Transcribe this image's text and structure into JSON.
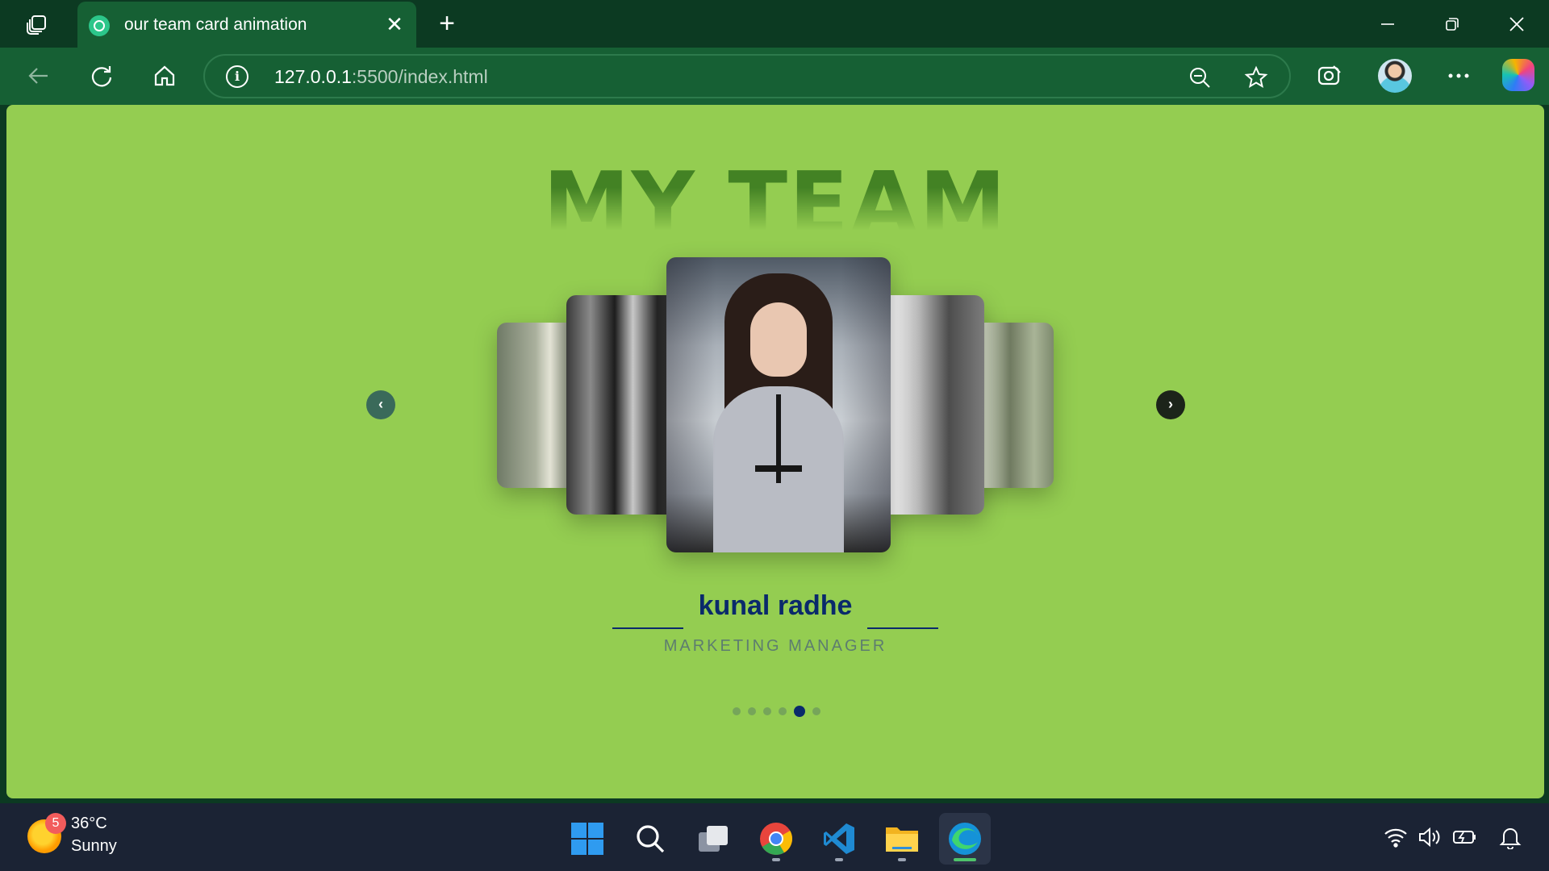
{
  "browser": {
    "tab": {
      "title": "our team card animation",
      "close": "✕"
    },
    "new_tab": "+",
    "address": {
      "host": "127.0.0.1",
      "path": ":5500/index.html"
    }
  },
  "page": {
    "title": "MY TEAM",
    "prev_arrow": "‹",
    "next_arrow": "›",
    "member": {
      "name": "kunal radhe",
      "role": "MARKETING MANAGER"
    },
    "pagination": {
      "count": 6,
      "active_index": 4
    }
  },
  "taskbar": {
    "weather": {
      "temp": "36°C",
      "condition": "Sunny",
      "badge": "5"
    }
  },
  "colors": {
    "page_bg": "#94cd51",
    "title": "#3e7d22",
    "name": "#0a2a6b",
    "role": "#5d7d6f",
    "browser_frame": "#0c3a22",
    "toolbar": "#166034",
    "taskbar": "#1b2334"
  },
  "icons": [
    "workspaces-icon",
    "back-icon",
    "refresh-icon",
    "home-icon",
    "info-icon",
    "zoom-out-icon",
    "favorite-star-icon",
    "screenshot-icon",
    "more-icon",
    "copilot-icon",
    "windows-start-icon",
    "search-icon",
    "task-view-icon",
    "chrome-icon",
    "vscode-icon",
    "file-explorer-icon",
    "edge-icon",
    "wifi-icon",
    "volume-icon",
    "battery-icon",
    "notification-bell-icon"
  ]
}
